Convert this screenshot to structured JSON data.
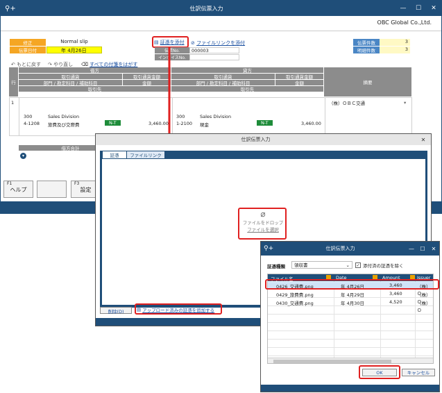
{
  "main": {
    "title": "仕訳伝票入力",
    "company": "OBC Global Co.,Ltd.",
    "status_badge": "修正",
    "slip_type": "Normal slip",
    "date_label": "伝票日付",
    "date_value": "年  4月26日",
    "attach_link": "証憑を添付",
    "file_link": "ファイルリンクを添付",
    "doc_no_label": "伝票No.",
    "doc_no_value": "000003",
    "invoice_label": "インボイスNo.",
    "slip_count_label": "伝票件数",
    "slip_count_value": "3",
    "detail_count_label": "明細件数",
    "detail_count_value": "3",
    "undo_label": "もとに戻す",
    "redo_label": "やり直し",
    "remove_sticky_label": "すべての付箋をはがす",
    "grid": {
      "row_label": "行",
      "debit": "借方",
      "credit": "貸方",
      "currency": "取引通貨",
      "currency_amount": "取引通貨金額",
      "account": "部門 / 勘定科目 / 補助科目",
      "amount": "金額",
      "partner": "取引先",
      "summary": "摘要",
      "row_no": "1",
      "summary_text": "（株）ＯＢＣ交通",
      "debit_dept_code": "300",
      "debit_dept": "Sales Division",
      "debit_account_code": "4-1208",
      "debit_account": "旅費及び交際費",
      "debit_tax": "N-T",
      "debit_amount": "3,460.00",
      "credit_dept_code": "300",
      "credit_dept": "Sales Division",
      "credit_account_code": "1-2100",
      "credit_account": "現金",
      "credit_tax": "N-T",
      "credit_amount": "3,460.00",
      "debit_total_label": "借方合計"
    },
    "fkeys": [
      {
        "key": "F1",
        "label": "ヘルプ"
      },
      {
        "key": "",
        "label": ""
      },
      {
        "key": "F3",
        "label": "設定"
      }
    ]
  },
  "dialog1": {
    "title": "仕訳伝票入力",
    "tabs": [
      "証憑",
      "ファイルリンク"
    ],
    "drop_text": "ファイルをドロップ",
    "select_link": "ファイルを選択",
    "delete_button": "削除(D)",
    "add_uploaded_link": "アップロード済みの証憑を追加する"
  },
  "dialog2": {
    "title": "仕訳伝票入力",
    "type_label": "証憑種類",
    "type_value": "領収書",
    "exclude_label": "添付済の証憑を除く",
    "columns": [
      "ファイル名",
      "Date",
      "Amount",
      "Issuer"
    ],
    "rows": [
      {
        "file": "0426_交通費.png",
        "date": "年 4月26日",
        "amount": "3,460",
        "issuer": "（株）Ｏ"
      },
      {
        "file": "0429_旅費費.png",
        "date": "年 4月29日",
        "amount": "3,460",
        "issuer": "（株）Ｏ"
      },
      {
        "file": "0430_交通費.png",
        "date": "年 4月30日",
        "amount": "4,520",
        "issuer": "（株）Ｏ"
      }
    ],
    "ok_button": "OK",
    "cancel_button": "キャンセル"
  },
  "colors": {
    "titlebar": "#1f4e79",
    "header_gray": "#8c8c8c",
    "highlight_red": "#e02020",
    "badge_orange": "#f5a623",
    "date_yellow": "#ffff00",
    "selected_row": "#cfe3f7"
  },
  "icons": [
    "key-plus-icon",
    "minimize-icon",
    "maximize-icon",
    "close-icon",
    "paperclip-icon",
    "undo-icon",
    "redo-icon",
    "eraser-icon",
    "chevron-down-icon",
    "checkbox-icon"
  ]
}
